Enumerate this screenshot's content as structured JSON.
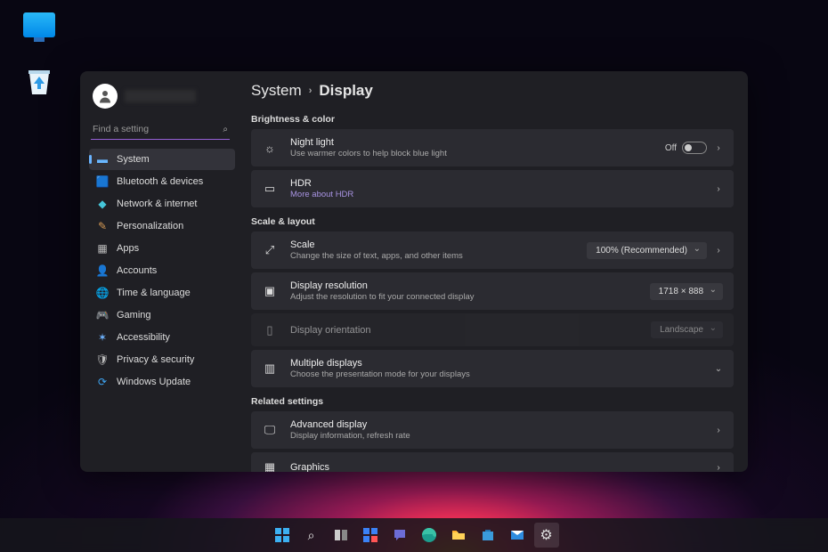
{
  "desktop": {
    "icons": [
      "this-pc",
      "recycle-bin"
    ]
  },
  "search": {
    "placeholder": "Find a setting"
  },
  "sidebar": {
    "items": [
      {
        "label": "System",
        "icon": "system",
        "active": true
      },
      {
        "label": "Bluetooth & devices",
        "icon": "bluetooth"
      },
      {
        "label": "Network & internet",
        "icon": "network"
      },
      {
        "label": "Personalization",
        "icon": "personalization"
      },
      {
        "label": "Apps",
        "icon": "apps"
      },
      {
        "label": "Accounts",
        "icon": "accounts"
      },
      {
        "label": "Time & language",
        "icon": "time"
      },
      {
        "label": "Gaming",
        "icon": "gaming"
      },
      {
        "label": "Accessibility",
        "icon": "accessibility"
      },
      {
        "label": "Privacy & security",
        "icon": "privacy"
      },
      {
        "label": "Windows Update",
        "icon": "update"
      }
    ]
  },
  "breadcrumb": {
    "parent": "System",
    "current": "Display"
  },
  "sections": {
    "brightness": {
      "title": "Brightness & color",
      "night_light": {
        "title": "Night light",
        "sub": "Use warmer colors to help block blue light",
        "state": "Off"
      },
      "hdr": {
        "title": "HDR",
        "sub": "More about HDR"
      }
    },
    "scale": {
      "title": "Scale & layout",
      "scale": {
        "title": "Scale",
        "sub": "Change the size of text, apps, and other items",
        "value": "100% (Recommended)"
      },
      "resolution": {
        "title": "Display resolution",
        "sub": "Adjust the resolution to fit your connected display",
        "value": "1718 × 888"
      },
      "orientation": {
        "title": "Display orientation",
        "value": "Landscape"
      },
      "multiple": {
        "title": "Multiple displays",
        "sub": "Choose the presentation mode for your displays"
      }
    },
    "related": {
      "title": "Related settings",
      "advanced": {
        "title": "Advanced display",
        "sub": "Display information, refresh rate"
      },
      "graphics": {
        "title": "Graphics"
      }
    }
  }
}
